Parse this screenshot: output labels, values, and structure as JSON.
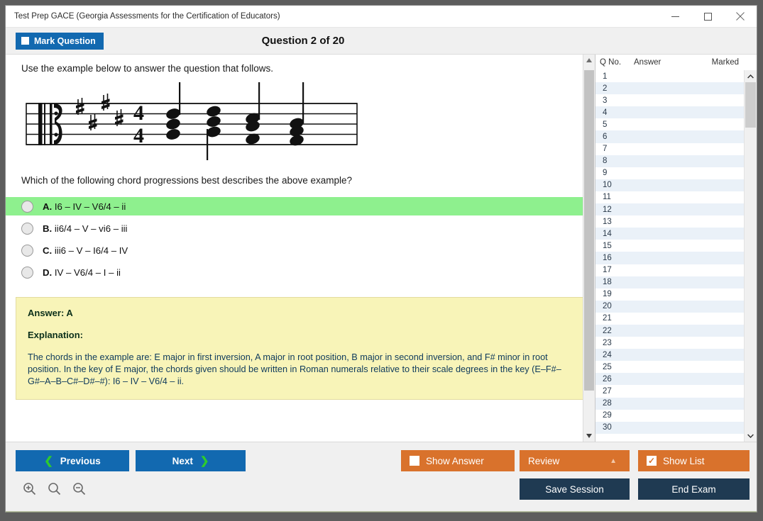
{
  "window": {
    "title": "Test Prep GACE (Georgia Assessments for the Certification of Educators)",
    "minimize_icon": "minimize-icon",
    "maximize_icon": "maximize-icon",
    "close_icon": "close-icon"
  },
  "header": {
    "mark_question_label": "Mark Question",
    "question_title": "Question 2 of 20"
  },
  "question": {
    "intro": "Use the example below to answer the question that follows.",
    "stem": "Which of the following chord progressions best describes the above example?",
    "notation": {
      "clef": "alto-clef",
      "key_signature_sharps": 4,
      "time_signature": "4/4",
      "chords": [
        "E major first inversion",
        "A major root position",
        "B major second inversion",
        "F# minor root position"
      ]
    },
    "options": [
      {
        "letter": "A.",
        "text": "I6 – IV – V6/4 – ii",
        "selected": true
      },
      {
        "letter": "B.",
        "text": "ii6/4 – V – vi6 – iii",
        "selected": false
      },
      {
        "letter": "C.",
        "text": "iii6 – V – I6/4 – IV",
        "selected": false
      },
      {
        "letter": "D.",
        "text": "IV – V6/4 – I – ii",
        "selected": false
      }
    ],
    "answer_line": "Answer: A",
    "explanation_label": "Explanation:",
    "explanation_text": "The chords in the example are: E major in first inversion, A major in root position, B major in second inversion, and F# minor in root position. In the key of E major, the chords given should be written in Roman numerals relative to their scale degrees in the key (E–F#–G#–A–B–C#–D#–#): I6 – IV – V6/4 – ii."
  },
  "list": {
    "columns": [
      "Q No.",
      "Answer",
      "Marked"
    ],
    "rows": [
      {
        "q": "1",
        "answer": "",
        "marked": ""
      },
      {
        "q": "2",
        "answer": "",
        "marked": ""
      },
      {
        "q": "3",
        "answer": "",
        "marked": ""
      },
      {
        "q": "4",
        "answer": "",
        "marked": ""
      },
      {
        "q": "5",
        "answer": "",
        "marked": ""
      },
      {
        "q": "6",
        "answer": "",
        "marked": ""
      },
      {
        "q": "7",
        "answer": "",
        "marked": ""
      },
      {
        "q": "8",
        "answer": "",
        "marked": ""
      },
      {
        "q": "9",
        "answer": "",
        "marked": ""
      },
      {
        "q": "10",
        "answer": "",
        "marked": ""
      },
      {
        "q": "11",
        "answer": "",
        "marked": ""
      },
      {
        "q": "12",
        "answer": "",
        "marked": ""
      },
      {
        "q": "13",
        "answer": "",
        "marked": ""
      },
      {
        "q": "14",
        "answer": "",
        "marked": ""
      },
      {
        "q": "15",
        "answer": "",
        "marked": ""
      },
      {
        "q": "16",
        "answer": "",
        "marked": ""
      },
      {
        "q": "17",
        "answer": "",
        "marked": ""
      },
      {
        "q": "18",
        "answer": "",
        "marked": ""
      },
      {
        "q": "19",
        "answer": "",
        "marked": ""
      },
      {
        "q": "20",
        "answer": "",
        "marked": ""
      },
      {
        "q": "21",
        "answer": "",
        "marked": ""
      },
      {
        "q": "22",
        "answer": "",
        "marked": ""
      },
      {
        "q": "23",
        "answer": "",
        "marked": ""
      },
      {
        "q": "24",
        "answer": "",
        "marked": ""
      },
      {
        "q": "25",
        "answer": "",
        "marked": ""
      },
      {
        "q": "26",
        "answer": "",
        "marked": ""
      },
      {
        "q": "27",
        "answer": "",
        "marked": ""
      },
      {
        "q": "28",
        "answer": "",
        "marked": ""
      },
      {
        "q": "29",
        "answer": "",
        "marked": ""
      },
      {
        "q": "30",
        "answer": "",
        "marked": ""
      }
    ]
  },
  "footer": {
    "previous_label": "Previous",
    "next_label": "Next",
    "show_answer_label": "Show Answer",
    "review_label": "Review",
    "show_list_label": "Show List",
    "save_session_label": "Save Session",
    "end_exam_label": "End Exam",
    "show_list_checked": true,
    "show_answer_checked": false,
    "zoom_in_icon": "zoom-in-icon",
    "zoom_reset_icon": "zoom-reset-icon",
    "zoom_out_icon": "zoom-out-icon"
  },
  "colors": {
    "primary_blue": "#1269b0",
    "orange": "#d9722c",
    "dark_navy": "#1f3a52",
    "selected_green": "#8ef08e",
    "answer_yellow": "#f8f4b8"
  }
}
